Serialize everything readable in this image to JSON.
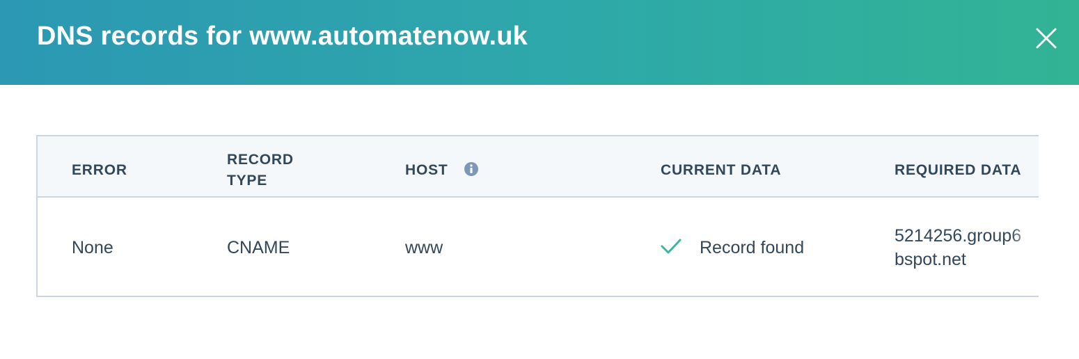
{
  "modal": {
    "title": "DNS records for www.automatenow.uk",
    "close_icon": "close-icon"
  },
  "table": {
    "headers": {
      "error": "ERROR",
      "record_type_line1": "RECORD",
      "record_type_line2": "TYPE",
      "host": "HOST",
      "current_data": "CURRENT DATA",
      "required_data": "REQUIRED DATA"
    },
    "host_info_icon": "info-icon",
    "rows": [
      {
        "error": "None",
        "record_type": "CNAME",
        "host": "www",
        "current_data": "Record found",
        "current_data_icon": "check-icon",
        "required_data_line1": "5214256.group6",
        "required_data_line2": "bspot.net"
      }
    ]
  },
  "colors": {
    "header_gradient_start": "#2c98b4",
    "header_gradient_end": "#32b394",
    "text": "#33475b",
    "border": "#cbd6e2",
    "check": "#3cb59a",
    "info": "#7c98b6"
  }
}
